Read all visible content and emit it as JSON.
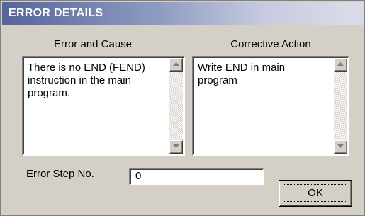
{
  "dialog": {
    "title": "ERROR DETAILS"
  },
  "error_cause": {
    "label": "Error and Cause",
    "text": "There is no END (FEND)\ninstruction in the main\nprogram."
  },
  "corrective_action": {
    "label": "Corrective Action",
    "text": "Write END in main\nprogram"
  },
  "error_step": {
    "label": "Error Step No.",
    "value": "0"
  },
  "buttons": {
    "ok_label": "OK"
  },
  "colors": {
    "titlebar_start": "#55659a",
    "titlebar_end": "#d8dbe7",
    "dialog_face": "#d4d0c8"
  }
}
